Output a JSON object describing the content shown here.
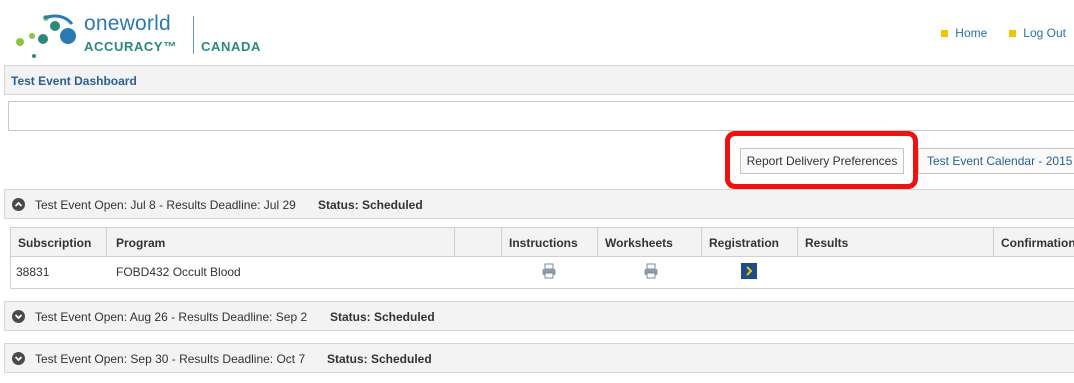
{
  "brand": {
    "line1": "oneworld",
    "line2": "ACCURACY™",
    "line3": "CANADA"
  },
  "nav": {
    "home": "Home",
    "logout": "Log Out"
  },
  "dashboard": {
    "title": "Test Event Dashboard"
  },
  "buttons": {
    "report_delivery": "Report Delivery Preferences",
    "calendar": "Test Event Calendar - 2015"
  },
  "events": [
    {
      "label": "Test Event Open: Jul 8 - Results Deadline: Jul 29",
      "status": "Status: Scheduled",
      "expanded": true
    },
    {
      "label": "Test Event Open: Aug 26 - Results Deadline: Sep 2",
      "status": "Status: Scheduled",
      "expanded": false
    },
    {
      "label": "Test Event Open: Sep 30 - Results Deadline: Oct 7",
      "status": "Status: Scheduled",
      "expanded": false
    }
  ],
  "table": {
    "headers": {
      "subscription": "Subscription",
      "program": "Program",
      "instructions": "Instructions",
      "worksheets": "Worksheets",
      "registration": "Registration",
      "results": "Results",
      "confirmation": "Confirmation"
    },
    "rows": [
      {
        "subscription": "38831",
        "program": "FOBD432 Occult Blood"
      }
    ]
  },
  "icons": {
    "instructions": "printer-icon",
    "worksheets": "printer-icon",
    "registration": "chevron-right-icon"
  },
  "colors": {
    "highlight": "#ee1111",
    "link": "#2a5f95",
    "bullet": "#f5c400",
    "registration_button": "#1d4c8c"
  }
}
